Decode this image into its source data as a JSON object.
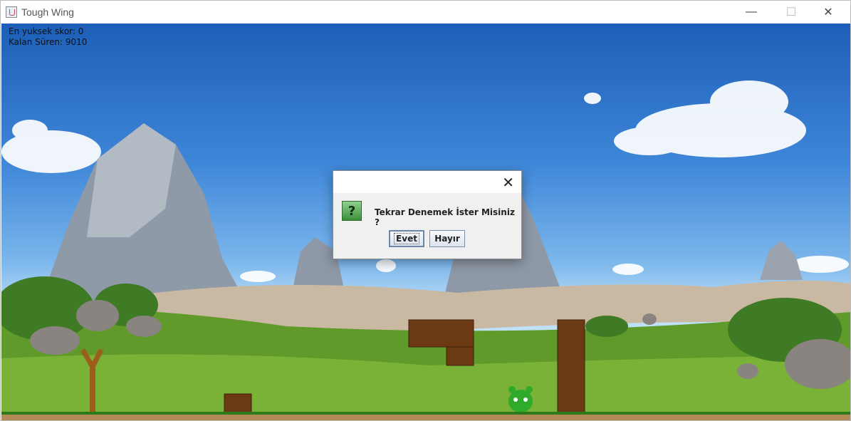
{
  "window": {
    "title": "Tough Wing",
    "controls": {
      "minimize": "—",
      "maximize": "☐",
      "close": "✕"
    }
  },
  "hud": {
    "high_score": "En yuksek skor: 0",
    "time_left": "Kalan Süren: 9010"
  },
  "dialog": {
    "close": "✕",
    "icon": "?",
    "message": "Tekrar Denemek İster Misiniz ?",
    "yes_label": "Evet",
    "no_label": "Hayır"
  },
  "colors": {
    "sky_top": "#1d5fb8",
    "grass": "#5f9a2a",
    "wood": "#6b3a12",
    "pig": "#2faa2a",
    "ground_line": "#2c7a1a",
    "dirt": "#b38a57"
  },
  "icons": {
    "app": "java-coffee-cup-icon",
    "dialog": "question-mark-icon"
  }
}
